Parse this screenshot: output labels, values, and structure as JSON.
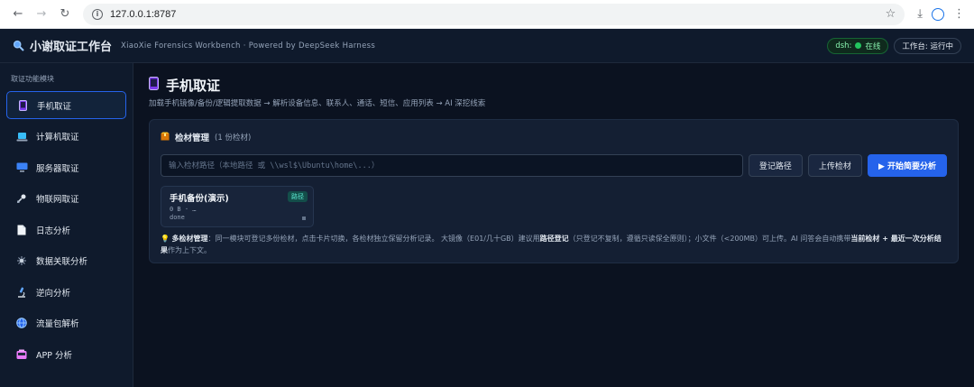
{
  "browser": {
    "url": "127.0.0.1:8787"
  },
  "header": {
    "title": "小谢取证工作台",
    "subtitle": "XiaoXie Forensics Workbench · Powered by DeepSeek Harness",
    "dsh_label": "dsh:",
    "dsh_status": "在线",
    "workspace_status": "工作台: 运行中",
    "colors": {
      "online": "#22c55e",
      "accent": "#2563eb"
    }
  },
  "sidebar": {
    "heading": "取证功能模块",
    "items": [
      {
        "label": "手机取证",
        "icon": "phone-icon",
        "active": true
      },
      {
        "label": "计算机取证",
        "icon": "laptop-icon"
      },
      {
        "label": "服务器取证",
        "icon": "server-icon"
      },
      {
        "label": "物联网取证",
        "icon": "satellite-icon"
      },
      {
        "label": "日志分析",
        "icon": "document-icon"
      },
      {
        "label": "数据关联分析",
        "icon": "network-icon"
      },
      {
        "label": "逆向分析",
        "icon": "microscope-icon"
      },
      {
        "label": "流量包解析",
        "icon": "globe-icon"
      },
      {
        "label": "APP 分析",
        "icon": "app-icon"
      }
    ]
  },
  "main": {
    "title": "手机取证",
    "description": "加载手机镜像/备份/逻辑提取数据 → 解析设备信息、联系人、通话、短信、应用列表 → AI 深挖线索",
    "evidence": {
      "title": "检材管理",
      "count": "(1 份检材)",
      "input_placeholder": "输入检材路径（本地路径 或 \\\\wsl$\\Ubuntu\\home\\...）",
      "register_button": "登记路径",
      "upload_button": "上传检材",
      "analyze_button": "▶ 开始简要分析",
      "tile": {
        "title": "手机备份(演示)",
        "tag": "路径",
        "size": "0 B · …",
        "status": "done"
      },
      "tip": {
        "label": "多检材管理",
        "text_1": "：同一模块可登记多份检材，点击卡片切换，各检材独立保留分析记录。 大镜像（E01/几十GB）建议用",
        "emph_1": "路径登记",
        "text_2": "（只登记不复制，遵循只读保全原则）；小文件（<200MB）可上传。AI 问答会自动携带",
        "emph_2": "当前检材 + 最近一次分析结果",
        "text_3": "作为上下文。"
      }
    }
  }
}
